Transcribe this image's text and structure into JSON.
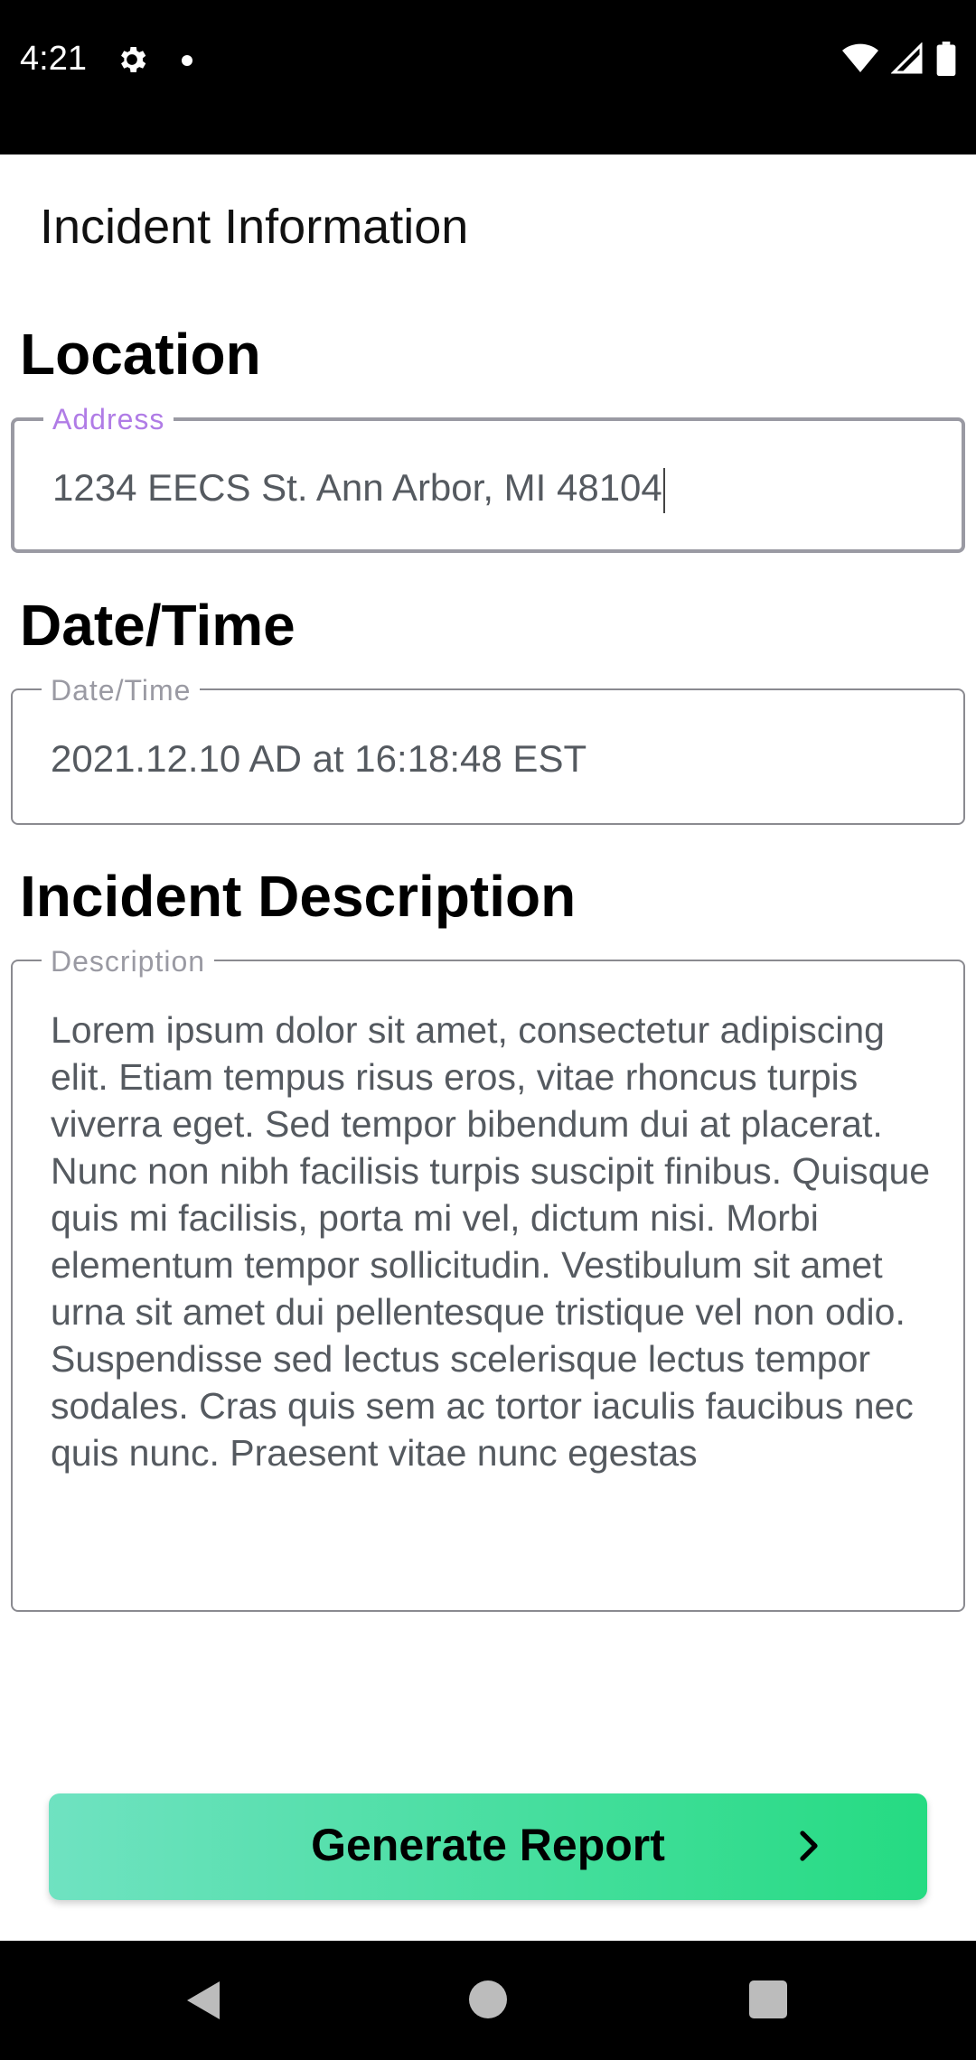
{
  "status_bar": {
    "time": "4:21",
    "icons": [
      "gear-icon",
      "notification-dot-icon",
      "wifi-icon",
      "cell-signal-icon",
      "battery-icon"
    ]
  },
  "app": {
    "title": "Incident Information"
  },
  "sections": {
    "location": {
      "heading": "Location",
      "field_label": "Address",
      "value": "1234 EECS St. Ann Arbor, MI 48104",
      "focused": true
    },
    "datetime": {
      "heading": "Date/Time",
      "field_label": "Date/Time",
      "value": "2021.12.10 AD at 16:18:48 EST"
    },
    "description": {
      "heading": "Incident Description",
      "field_label": "Description",
      "value": "Lorem ipsum dolor sit amet, consectetur adipiscing elit. Etiam tempus risus eros, vitae rhoncus turpis viverra eget. Sed tempor bibendum dui at placerat. Nunc non nibh facilisis turpis suscipit finibus. Quisque quis mi facilisis, porta mi vel, dictum nisi. Morbi elementum tempor sollicitudin. Vestibulum sit amet urna sit amet dui pellentesque tristique vel non odio. Suspendisse sed lectus scelerisque lectus tempor sodales. Cras quis sem ac tortor iaculis faucibus nec quis nunc. Praesent vitae nunc egestas"
    }
  },
  "actions": {
    "generate_label": "Generate Report",
    "generate_icon": "chevron-right-icon"
  },
  "nav_bar": {
    "buttons": [
      "back-icon",
      "home-icon",
      "recents-icon"
    ]
  },
  "colors": {
    "focus_label": "#b07ce6",
    "button_gradient_start": "#6fe2c1",
    "button_gradient_end": "#25db82"
  }
}
